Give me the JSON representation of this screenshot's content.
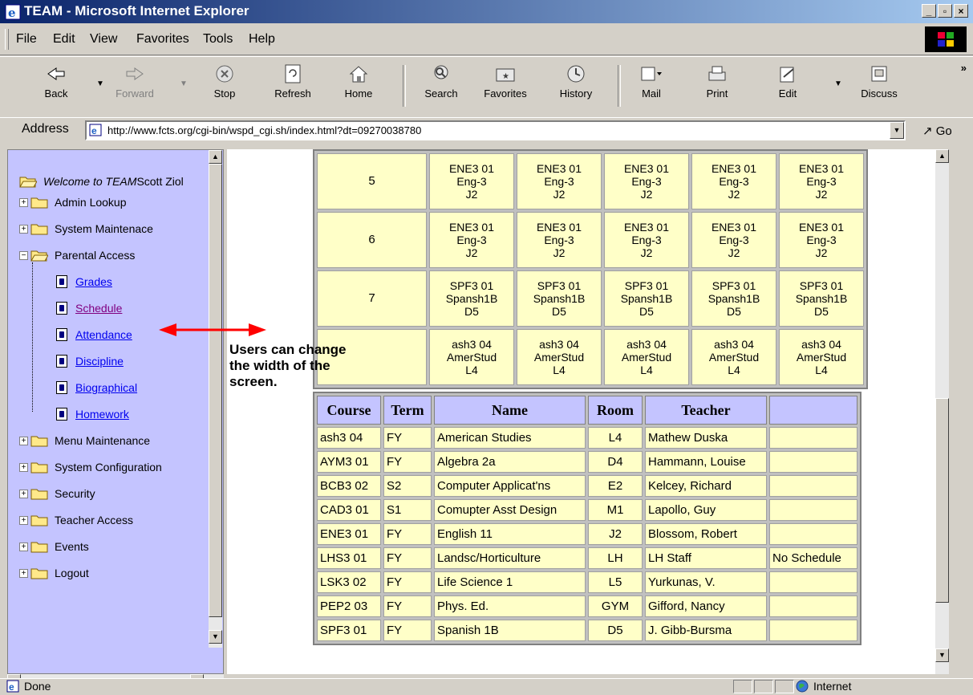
{
  "window": {
    "title": "TEAM - Microsoft Internet Explorer",
    "buttons": [
      "minimize",
      "maximize",
      "close"
    ]
  },
  "menu": {
    "items": [
      "File",
      "Edit",
      "View",
      "Favorites",
      "Tools",
      "Help"
    ]
  },
  "toolbar": {
    "back": "Back",
    "forward": "Forward",
    "stop": "Stop",
    "refresh": "Refresh",
    "home": "Home",
    "search": "Search",
    "favorites": "Favorites",
    "history": "History",
    "mail": "Mail",
    "print": "Print",
    "edit": "Edit",
    "discuss": "Discuss",
    "more": "»"
  },
  "address": {
    "label": "Address",
    "url": "http://www.fcts.org/cgi-bin/wspd_cgi.sh/index.html?dt=09270038780",
    "go": "Go"
  },
  "tree": {
    "welcome": "Welcome to TEAM",
    "user": " Scott Ziol",
    "items": {
      "admin": "Admin Lookup",
      "sysmaint": "System Maintenace",
      "parental": "Parental Access",
      "grades": "Grades",
      "schedule": "Schedule",
      "attendance": "Attendance",
      "discipline": "Discipline",
      "bio": "Biographical",
      "homework": "Homework",
      "menumaint": "Menu Maintenance",
      "sysconfig": "System Configuration",
      "security": "Security",
      "teacher": "Teacher Access",
      "events": "Events",
      "logout": "Logout"
    }
  },
  "schedule": {
    "rows": [
      {
        "period": "5",
        "cells": [
          [
            "ENE3 01",
            "Eng-3",
            "J2"
          ],
          [
            "ENE3 01",
            "Eng-3",
            "J2"
          ],
          [
            "ENE3 01",
            "Eng-3",
            "J2"
          ],
          [
            "ENE3 01",
            "Eng-3",
            "J2"
          ],
          [
            "ENE3 01",
            "Eng-3",
            "J2"
          ]
        ]
      },
      {
        "period": "6",
        "cells": [
          [
            "ENE3 01",
            "Eng-3",
            "J2"
          ],
          [
            "ENE3 01",
            "Eng-3",
            "J2"
          ],
          [
            "ENE3 01",
            "Eng-3",
            "J2"
          ],
          [
            "ENE3 01",
            "Eng-3",
            "J2"
          ],
          [
            "ENE3 01",
            "Eng-3",
            "J2"
          ]
        ]
      },
      {
        "period": "7",
        "cells": [
          [
            "SPF3 01",
            "Spansh1B",
            "D5"
          ],
          [
            "SPF3 01",
            "Spansh1B",
            "D5"
          ],
          [
            "SPF3 01",
            "Spansh1B",
            "D5"
          ],
          [
            "SPF3 01",
            "Spansh1B",
            "D5"
          ],
          [
            "SPF3 01",
            "Spansh1B",
            "D5"
          ]
        ]
      },
      {
        "period": "",
        "cells": [
          [
            "ash3 04",
            "AmerStud",
            "L4"
          ],
          [
            "ash3 04",
            "AmerStud",
            "L4"
          ],
          [
            "ash3 04",
            "AmerStud",
            "L4"
          ],
          [
            "ash3 04",
            "AmerStud",
            "L4"
          ],
          [
            "ash3 04",
            "AmerStud",
            "L4"
          ]
        ]
      }
    ]
  },
  "courses": {
    "headers": [
      "Course",
      "Term",
      "Name",
      "Room",
      "Teacher",
      ""
    ],
    "rows": [
      [
        "ash3 04",
        "FY",
        "American Studies",
        "L4",
        "Mathew Duska",
        ""
      ],
      [
        "AYM3 01",
        "FY",
        "Algebra 2a",
        "D4",
        "Hammann, Louise",
        ""
      ],
      [
        "BCB3 02",
        "S2",
        "Computer Applicat'ns",
        "E2",
        "Kelcey, Richard",
        ""
      ],
      [
        "CAD3 01",
        "S1",
        "Comupter Asst Design",
        "M1",
        "Lapollo, Guy",
        ""
      ],
      [
        "ENE3 01",
        "FY",
        "English 11",
        "J2",
        "Blossom, Robert",
        ""
      ],
      [
        "LHS3 01",
        "FY",
        "Landsc/Horticulture",
        "LH",
        "LH Staff",
        "No Schedule"
      ],
      [
        "LSK3 02",
        "FY",
        "Life Science 1",
        "L5",
        "Yurkunas, V.",
        ""
      ],
      [
        "PEP2 03",
        "FY",
        "Phys. Ed.",
        "GYM",
        "Gifford, Nancy",
        ""
      ],
      [
        "SPF3 01",
        "FY",
        "Spanish 1B",
        "D5",
        "J. Gibb-Bursma",
        ""
      ]
    ]
  },
  "annotation": {
    "line1": "Users can change",
    "line2": "the width of the",
    "line3": "screen."
  },
  "status": {
    "text": "Done",
    "zone": "Internet"
  },
  "colors": {
    "title_gradient_start": "#0a246a",
    "tree_bg": "#c4c4ff",
    "cell_bg": "#ffffc8",
    "arrow": "#ff0000"
  }
}
